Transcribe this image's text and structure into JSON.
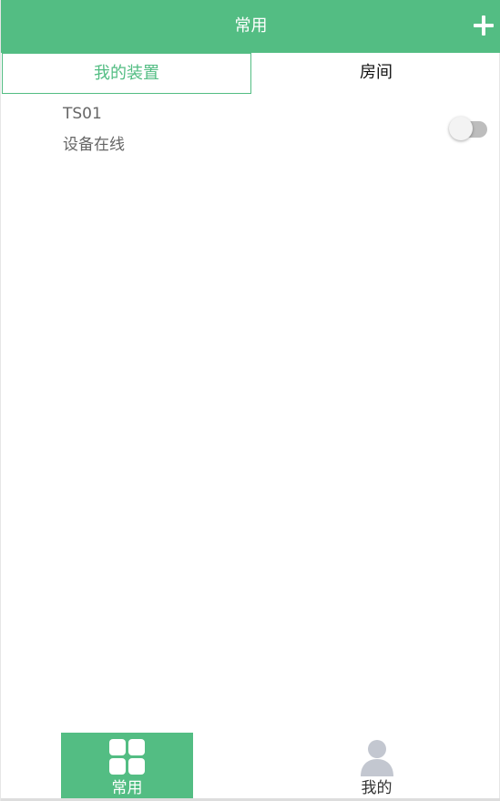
{
  "header": {
    "title": "常用",
    "add_icon": "plus-icon"
  },
  "tabs": [
    {
      "label": "我的装置",
      "active": true
    },
    {
      "label": "房间",
      "active": false
    }
  ],
  "devices": [
    {
      "name": "TS01",
      "status": "设备在线",
      "switch_on": false
    }
  ],
  "bottom_nav": [
    {
      "label": "常用",
      "icon": "grid-icon",
      "active": true
    },
    {
      "label": "我的",
      "icon": "person-icon",
      "active": false
    }
  ],
  "colors": {
    "accent": "#53bd83",
    "toggle_off_track": "#bdbdbd",
    "toggle_thumb": "#f3f3f3",
    "nav_inactive_icon": "#c3c7d0"
  }
}
